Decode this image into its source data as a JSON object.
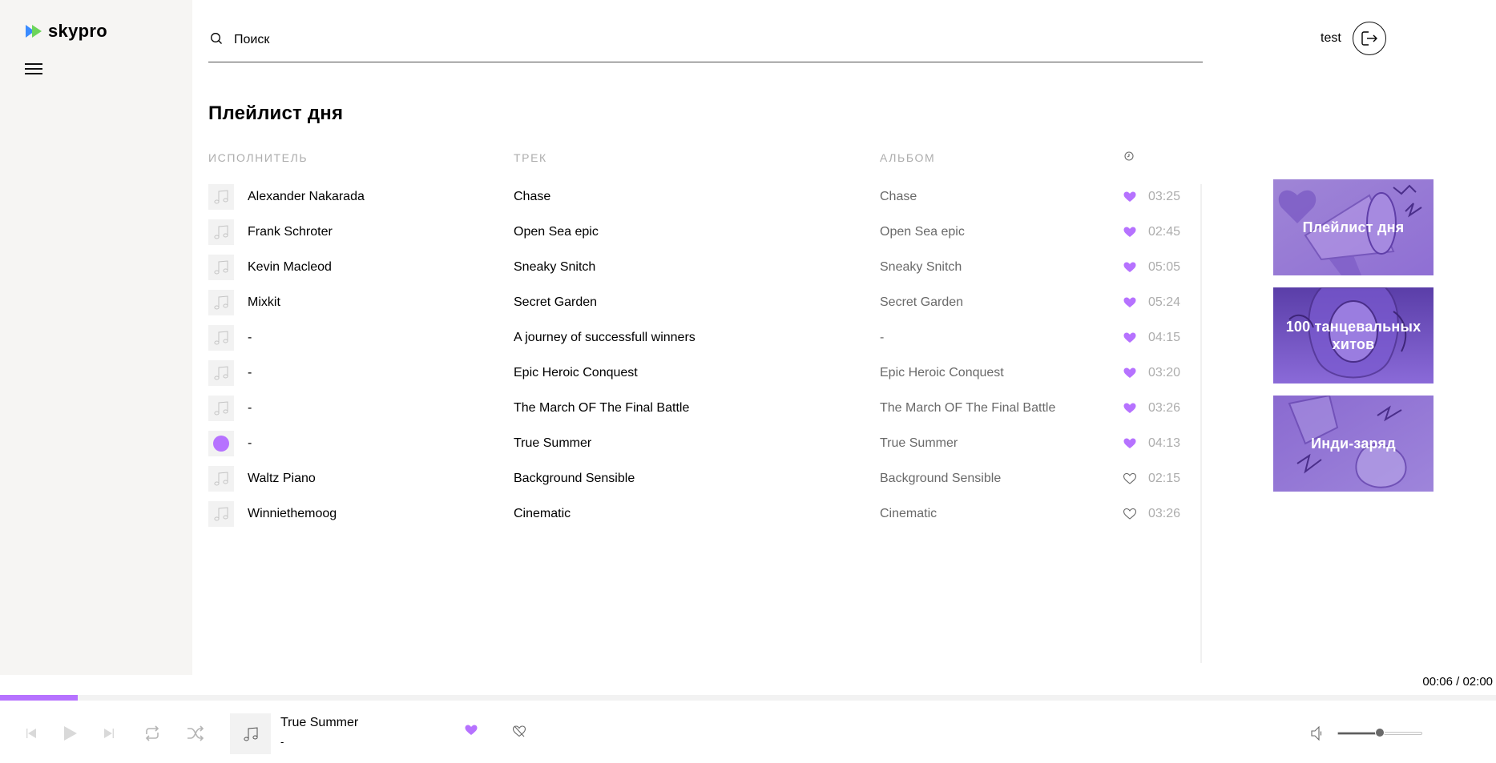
{
  "brand": {
    "logo_text": "skypro",
    "logo_colors": [
      "#6dd55b",
      "#3a8bff"
    ]
  },
  "search": {
    "placeholder": "Поиск"
  },
  "user": {
    "name": "test"
  },
  "page_title": "Плейлист дня",
  "columns": {
    "artist": "ИСПОЛНИТЕЛЬ",
    "track": "ТРЕК",
    "album": "АЛЬБОМ",
    "duration_icon": "clock-icon"
  },
  "tracks": [
    {
      "artist": "Alexander Nakarada",
      "title": "Chase",
      "album": "Chase",
      "liked": true,
      "time": "03:25",
      "playing": false
    },
    {
      "artist": "Frank Schroter",
      "title": "Open Sea epic",
      "album": "Open Sea epic",
      "liked": true,
      "time": "02:45",
      "playing": false
    },
    {
      "artist": "Kevin Macleod",
      "title": "Sneaky Snitch",
      "album": "Sneaky Snitch",
      "liked": true,
      "time": "05:05",
      "playing": false
    },
    {
      "artist": "Mixkit",
      "title": "Secret Garden",
      "album": "Secret Garden",
      "liked": true,
      "time": "05:24",
      "playing": false
    },
    {
      "artist": "-",
      "title": "A journey of successfull winners",
      "album": "-",
      "liked": true,
      "time": "04:15",
      "playing": false
    },
    {
      "artist": "-",
      "title": "Epic Heroic Conquest",
      "album": "Epic Heroic Conquest",
      "liked": true,
      "time": "03:20",
      "playing": false
    },
    {
      "artist": "-",
      "title": "The March OF The Final Battle",
      "album": "The March OF The Final Battle",
      "liked": true,
      "time": "03:26",
      "playing": false
    },
    {
      "artist": "-",
      "title": "True Summer",
      "album": "True Summer",
      "liked": true,
      "time": "04:13",
      "playing": true
    },
    {
      "artist": "Waltz Piano",
      "title": "Background Sensible",
      "album": "Background Sensible",
      "liked": false,
      "time": "02:15",
      "playing": false
    },
    {
      "artist": "Winniethemoog",
      "title": "Cinematic",
      "album": "Cinematic",
      "liked": false,
      "time": "03:26",
      "playing": false
    }
  ],
  "playlists": [
    {
      "label": "Плейлист дня",
      "icon": "megaphone-illustration"
    },
    {
      "label": "100 танцевальных хитов",
      "icon": "woman-portrait-illustration"
    },
    {
      "label": "Инди-заряд",
      "icon": "hand-lightning-illustration"
    }
  ],
  "player": {
    "progress_fraction": 0.052,
    "time_readout": "00:06 / 02:00",
    "track_title": "True Summer",
    "track_artist": "-",
    "liked": true,
    "volume_fraction": 0.5
  },
  "colors": {
    "accent": "#b672ff",
    "sidebar_bg": "#f6f5f3",
    "muted": "#adadad",
    "album_text": "#696969"
  }
}
